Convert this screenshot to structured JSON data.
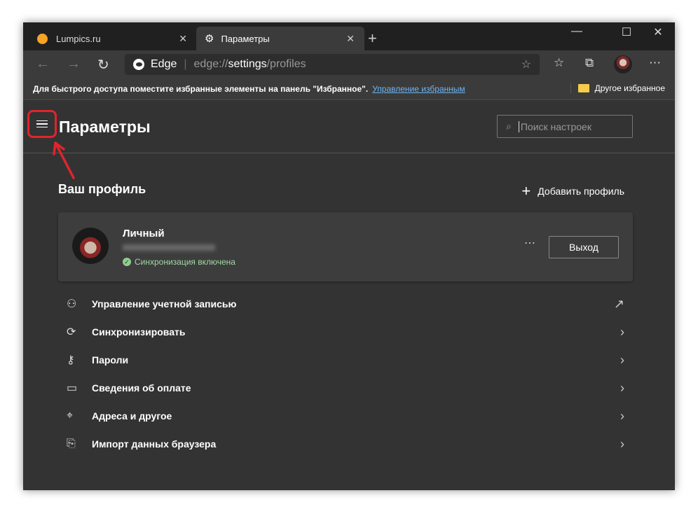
{
  "tabs": [
    {
      "label": "Lumpics.ru",
      "icon": "orange-dot-icon"
    },
    {
      "label": "Параметры",
      "icon": "gear-icon"
    }
  ],
  "address": {
    "brand": "Edge",
    "url_prefix": "edge://",
    "url_bold": "settings",
    "url_suffix": "/profiles"
  },
  "favorites_bar": {
    "message": "Для быстрого доступа поместите избранные элементы на панель \"Избранное\".",
    "link": "Управление избранным",
    "other": "Другое избранное"
  },
  "settings": {
    "title": "Параметры",
    "search_placeholder": "Поиск настроек",
    "section_title": "Ваш профиль",
    "add_profile": "Добавить профиль",
    "profile": {
      "name": "Личный",
      "sync_status": "Синхронизация включена",
      "logout": "Выход"
    },
    "items": [
      {
        "label": "Управление учетной записью",
        "icon": "person-icon",
        "action": "external-link-icon"
      },
      {
        "label": "Синхронизировать",
        "icon": "sync-icon",
        "action": "chevron-right-icon"
      },
      {
        "label": "Пароли",
        "icon": "key-icon",
        "action": "chevron-right-icon"
      },
      {
        "label": "Сведения об оплате",
        "icon": "card-icon",
        "action": "chevron-right-icon"
      },
      {
        "label": "Адреса и другое",
        "icon": "location-icon",
        "action": "chevron-right-icon"
      },
      {
        "label": "Импорт данных браузера",
        "icon": "import-icon",
        "action": "chevron-right-icon"
      }
    ]
  },
  "colors": {
    "annotation": "#e0242c",
    "link": "#6cb4f5",
    "sync": "#a5d6a7"
  }
}
